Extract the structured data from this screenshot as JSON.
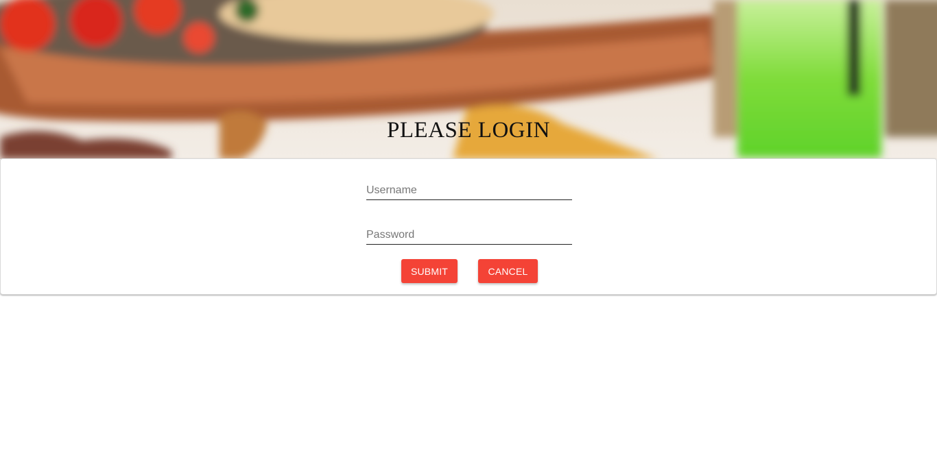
{
  "header": {
    "title": "PLEASE LOGIN"
  },
  "form": {
    "username_placeholder": "Username",
    "username_value": "",
    "password_placeholder": "Password",
    "password_value": "",
    "submit_label": "SUBMIT",
    "cancel_label": "CANCEL"
  },
  "colors": {
    "accent": "#f44336",
    "title": "#111111",
    "input_underline": "#222222"
  }
}
